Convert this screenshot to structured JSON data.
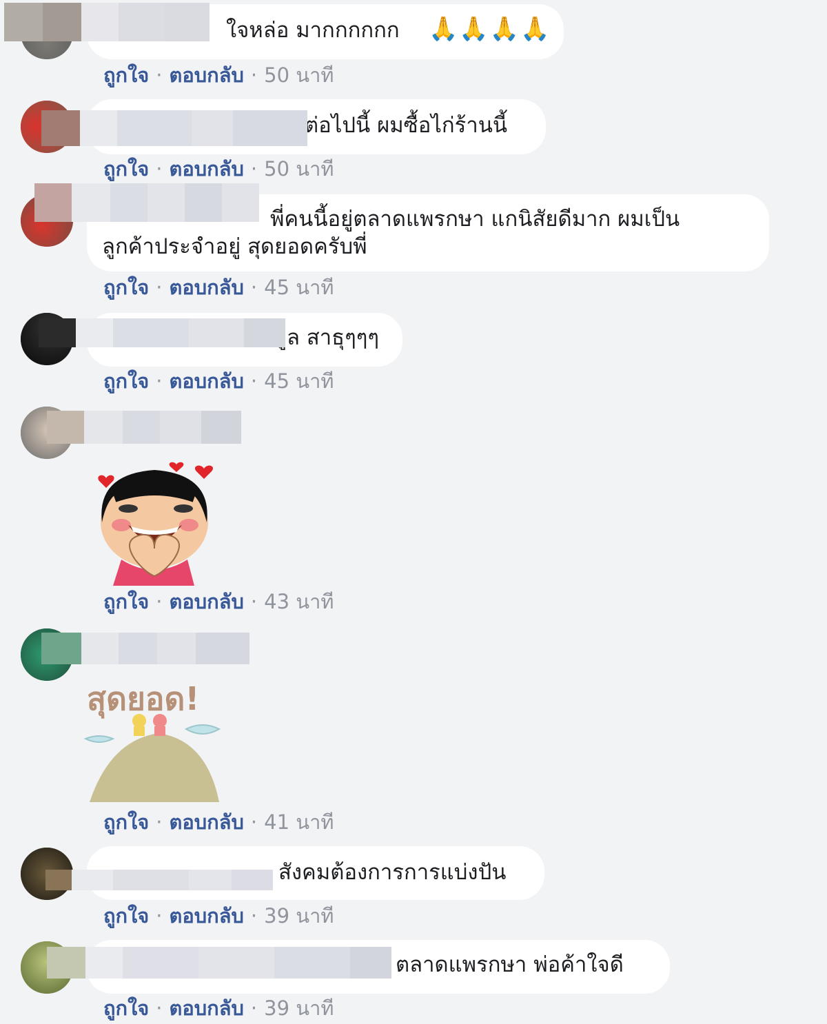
{
  "actions": {
    "like": "ถูกใจ",
    "reply": "ตอบกลับ",
    "dot": "·"
  },
  "comments": [
    {
      "text": "ใจหล่อ มากกกกกก",
      "emoji": "🙏🙏🙏🙏",
      "time": "50 นาที"
    },
    {
      "text": "ต่อไปนี้ ผมซื้อไก่ร้านนี้",
      "time": "50 นาที"
    },
    {
      "text": "พี่คนนี้อยู่ตลาดแพรกษา แกนิสัยดีมาก ผมเป็น",
      "text2": "ลูกค้าประจำอยู่ สุดยอดครับพี่",
      "time": "45 นาที"
    },
    {
      "text": "ูล สาธุๆๆๆ",
      "time": "45 นาที"
    },
    {
      "sticker": "heart-hands-girl-sticker",
      "time": "43 นาที"
    },
    {
      "sticker_text": "สุดยอด!",
      "time": "41 นาที"
    },
    {
      "text": "สังคมต้องการการแบ่งปัน",
      "time": "39 นาที"
    },
    {
      "text": "ตลาดแพรกษา พ่อค้าใจดี",
      "time": "39 นาที"
    }
  ]
}
